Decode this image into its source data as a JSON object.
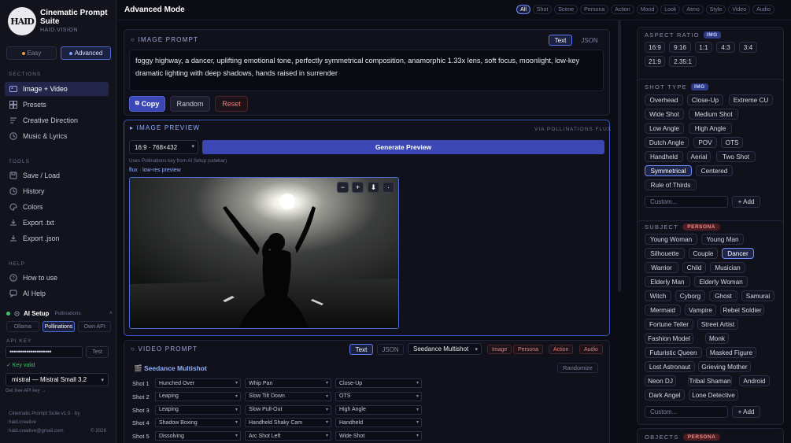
{
  "brand": {
    "logo_text": "HAID",
    "title": "Cinematic Prompt Suite",
    "subtitle": "HAID.VISION"
  },
  "mode": {
    "easy": "Easy",
    "advanced": "Advanced"
  },
  "sidebar": {
    "sections_label": "SECTIONS",
    "sections": [
      "Image + Video",
      "Presets",
      "Creative Direction",
      "Music & Lyrics"
    ],
    "tools_label": "TOOLS",
    "tools": [
      "Save / Load",
      "History",
      "Colors",
      "Export .txt",
      "Export .json"
    ],
    "help_label": "HELP",
    "help": [
      "How to use",
      "AI Help"
    ]
  },
  "ai_setup": {
    "title": "AI Setup",
    "status": "Pollinations",
    "providers": [
      "Ollama",
      "Pollinations",
      "Own API"
    ],
    "api_key_label": "API KEY",
    "api_key_value": "••••••••••••••••••••",
    "test": "Test",
    "key_valid": "✓ Key valid",
    "model": "mistral — Mistral Small 3.2",
    "free_api": "Get free API key →"
  },
  "footer": {
    "line1": "Cinematic Prompt Suite v1.0 · by",
    "line2": "haid.creative",
    "line3": "haid.creative@gmail.com",
    "year": "© 2026"
  },
  "topbar": {
    "title": "Advanced Mode",
    "filters": [
      "All",
      "Shot",
      "Scene",
      "Persona",
      "Action",
      "Mood",
      "Look",
      "Atmo",
      "Style",
      "Video",
      "Audio"
    ]
  },
  "image_prompt": {
    "title": "IMAGE PROMPT",
    "tab_text": "Text",
    "tab_json": "JSON",
    "text": "foggy highway, a dancer, uplifting emotional tone, perfectly symmetrical composition, anamorphic 1.33x lens, soft focus, moonlight, low-key dramatic lighting with deep shadows, hands raised in surrender",
    "copy": "Copy",
    "random": "Random",
    "reset": "Reset"
  },
  "image_preview": {
    "title": "IMAGE PREVIEW",
    "via": "VIA POLLINATIONS FLUX",
    "size": "16:9 · 768×432",
    "generate": "Generate Preview",
    "note": "Uses Pollinations key from AI Setup (sidebar)",
    "model_note": "flux · low-res preview",
    "controls": [
      "−",
      "+",
      "⬇",
      "·"
    ]
  },
  "video_prompt": {
    "title": "VIDEO PROMPT",
    "tab_text": "Text",
    "tab_json": "JSON",
    "model": "Seedance Multishot",
    "tags": [
      "Image",
      "Persona",
      "Action",
      "Audio"
    ],
    "sub_title": "Seedance Multishot",
    "randomize": "Randomize",
    "shots": [
      {
        "label": "Shot 1",
        "a": "Hunched Over",
        "b": "Whip Pan",
        "c": "Close-Up"
      },
      {
        "label": "Shot 2",
        "a": "Leaping",
        "b": "Slow Tilt Down",
        "c": "OTS"
      },
      {
        "label": "Shot 3",
        "a": "Leaping",
        "b": "Slow Pull-Out",
        "c": "High Angle"
      },
      {
        "label": "Shot 4",
        "a": "Shadow Boxing",
        "b": "Handheld Shaky Cam",
        "c": "Handheld"
      },
      {
        "label": "Shot 5",
        "a": "Dissolving",
        "b": "Arc Shot Left",
        "c": "Wide Shot"
      }
    ]
  },
  "right": {
    "aspect": {
      "title": "ASPECT RATIO",
      "badge": "IMG",
      "options": [
        "16:9",
        "9:16",
        "1:1",
        "4:3",
        "3:4",
        "21:9",
        "2.35:1"
      ]
    },
    "shot_type": {
      "title": "SHOT TYPE",
      "badge": "IMG",
      "options": [
        "Overhead",
        "Close-Up",
        "Extreme CU",
        "Wide Shot",
        "Medium Shot",
        "Low Angle",
        "High Angle",
        "Dutch Angle",
        "POV",
        "OTS",
        "Handheld",
        "Aerial",
        "Two Shot",
        "Symmetrical",
        "Centered",
        "Rule of Thirds"
      ],
      "selected": "Symmetrical",
      "custom_placeholder": "Custom...",
      "add": "+ Add"
    },
    "subject": {
      "title": "SUBJECT",
      "badge": "PERSONA",
      "options": [
        "Young Woman",
        "Young Man",
        "Silhouette",
        "Couple",
        "Dancer",
        "Warrior",
        "Child",
        "Musician",
        "Elderly Man",
        "Elderly Woman",
        "Witch",
        "Cyborg",
        "Ghost",
        "Samurai",
        "Mermaid",
        "Vampire",
        "Rebel Soldier",
        "Fortune Teller",
        "Street Artist",
        "Fashion Model",
        "Monk",
        "Futuristic Queen",
        "Masked Figure",
        "Lost Astronaut",
        "Grieving Mother",
        "Neon DJ",
        "Tribal Shaman",
        "Android",
        "Dark Angel",
        "Lone Detective"
      ],
      "selected": "Dancer",
      "custom_placeholder": "Custom...",
      "add": "+ Add"
    },
    "objects": {
      "title": "OBJECTS",
      "badge": "PERSONA"
    }
  },
  "colors": {
    "accent": "#3a47b5",
    "bg": "#0b0c14",
    "persona": "#ef7c78",
    "valid": "#3bc46b"
  }
}
